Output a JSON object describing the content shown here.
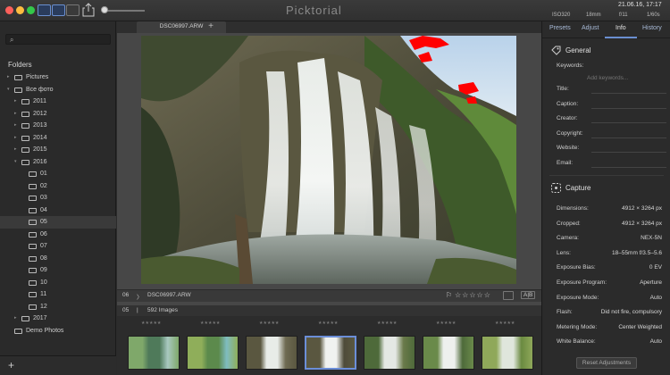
{
  "app": {
    "title": "Picktorial"
  },
  "header": {
    "date": "21.06.16, 17:17",
    "iso": "ISO320",
    "focal": "18mm",
    "aperture": "f/11",
    "shutter": "1/60s"
  },
  "sidebar": {
    "search_placeholder": "",
    "folders_title": "Folders",
    "items": [
      {
        "label": "Pictures",
        "indent": 0,
        "arrow": "▸"
      },
      {
        "label": "Все фото",
        "indent": 0,
        "arrow": "▾"
      },
      {
        "label": "2011",
        "indent": 1,
        "arrow": "▸"
      },
      {
        "label": "2012",
        "indent": 1,
        "arrow": "▸"
      },
      {
        "label": "2013",
        "indent": 1,
        "arrow": "▸"
      },
      {
        "label": "2014",
        "indent": 1,
        "arrow": "▸"
      },
      {
        "label": "2015",
        "indent": 1,
        "arrow": "▸"
      },
      {
        "label": "2016",
        "indent": 1,
        "arrow": "▾"
      },
      {
        "label": "01",
        "indent": 2,
        "arrow": ""
      },
      {
        "label": "02",
        "indent": 2,
        "arrow": ""
      },
      {
        "label": "03",
        "indent": 2,
        "arrow": ""
      },
      {
        "label": "04",
        "indent": 2,
        "arrow": ""
      },
      {
        "label": "05",
        "indent": 2,
        "arrow": "",
        "selected": true
      },
      {
        "label": "06",
        "indent": 2,
        "arrow": ""
      },
      {
        "label": "07",
        "indent": 2,
        "arrow": ""
      },
      {
        "label": "08",
        "indent": 2,
        "arrow": ""
      },
      {
        "label": "09",
        "indent": 2,
        "arrow": ""
      },
      {
        "label": "10",
        "indent": 2,
        "arrow": ""
      },
      {
        "label": "11",
        "indent": 2,
        "arrow": ""
      },
      {
        "label": "12",
        "indent": 2,
        "arrow": ""
      },
      {
        "label": "2017",
        "indent": 1,
        "arrow": "▸"
      },
      {
        "label": "Demo Photos",
        "indent": 0,
        "arrow": ""
      }
    ],
    "smart_label": "Smart...",
    "add_label": "+"
  },
  "viewer": {
    "tab_label": "DSC06997.ARW",
    "tab_add": "+",
    "info_index": "06",
    "info_chevron": "〉",
    "info_file": "DSC06997.ARW",
    "stars": "☆☆☆☆☆",
    "flag": "⚐",
    "ab_label": "A|B",
    "count_folder": "05",
    "count_sep": "|",
    "count_text": "592 Images",
    "thumb_stars": "★★★★★"
  },
  "right_panel": {
    "tabs": [
      "Presets",
      "Adjust",
      "Info",
      "History"
    ],
    "active_tab": "Info",
    "general": {
      "title": "General",
      "keywords_label": "Keywords:",
      "keywords_placeholder": "Add keywords...",
      "fields": [
        "Title:",
        "Caption:",
        "Creator:",
        "Copyright:",
        "Website:",
        "Email:"
      ]
    },
    "capture": {
      "title": "Capture",
      "rows": [
        {
          "label": "Dimensions:",
          "value": "4912 × 3264 px"
        },
        {
          "label": "Cropped:",
          "value": "4912 × 3264 px"
        },
        {
          "label": "Camera:",
          "value": "NEX-5N"
        },
        {
          "label": "Lens:",
          "value": "18–55mm f/3.5–5.6"
        },
        {
          "label": "Exposure Bias:",
          "value": "0 EV"
        },
        {
          "label": "Exposure Program:",
          "value": "Aperture"
        },
        {
          "label": "Exposure Mode:",
          "value": "Auto"
        },
        {
          "label": "Flash:",
          "value": "Did not fire, compulsory"
        },
        {
          "label": "Metering Mode:",
          "value": "Center Weighted"
        },
        {
          "label": "White Balance:",
          "value": "Auto"
        }
      ]
    },
    "reset_label": "Reset Adjustments"
  },
  "colors": {
    "accent": "#6a8fd0",
    "background": "#2b2b2b",
    "clipping": "#ff0000"
  }
}
